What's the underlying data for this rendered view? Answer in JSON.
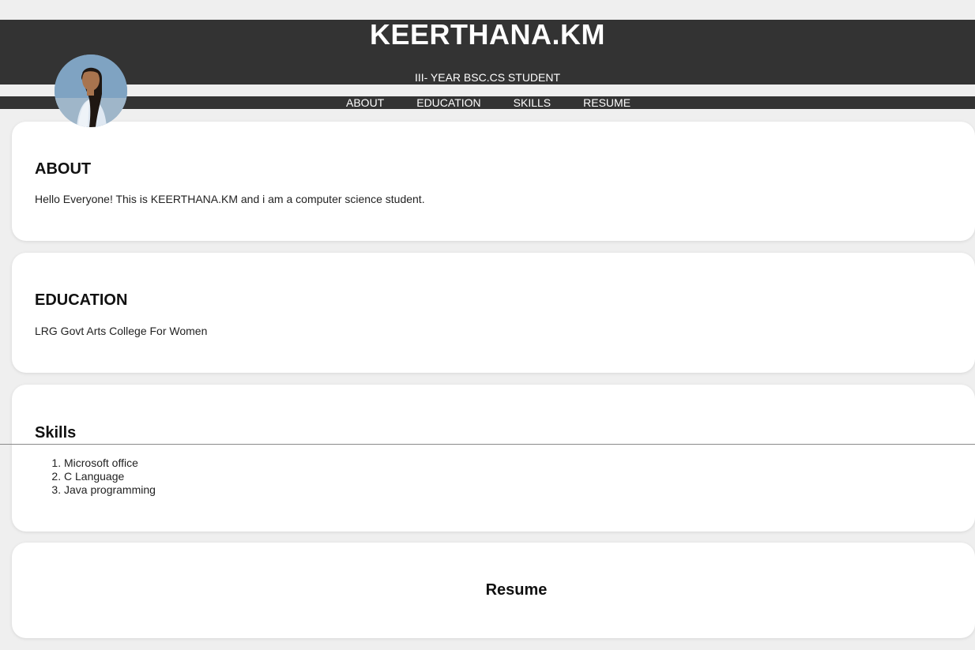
{
  "header": {
    "title": "KEERTHANA.KM",
    "subtitle": "III- YEAR BSC.CS STUDENT"
  },
  "nav": {
    "items": [
      {
        "label": "ABOUT"
      },
      {
        "label": "EDUCATION"
      },
      {
        "label": "SKILLS"
      },
      {
        "label": "RESUME"
      }
    ]
  },
  "about": {
    "title": "ABOUT",
    "text": "Hello Everyone! This is KEERTHANA.KM and i am a computer science student."
  },
  "education": {
    "title": "EDUCATION",
    "text": "LRG Govt Arts College For Women"
  },
  "skills": {
    "title": "Skills",
    "items": [
      "Microsoft office",
      "C Language",
      "Java programming"
    ]
  },
  "resume": {
    "title": "Resume"
  },
  "colors": {
    "header_bg": "#333333",
    "page_bg": "#efefef",
    "card_bg": "#ffffff",
    "header_text": "#ffffff"
  }
}
